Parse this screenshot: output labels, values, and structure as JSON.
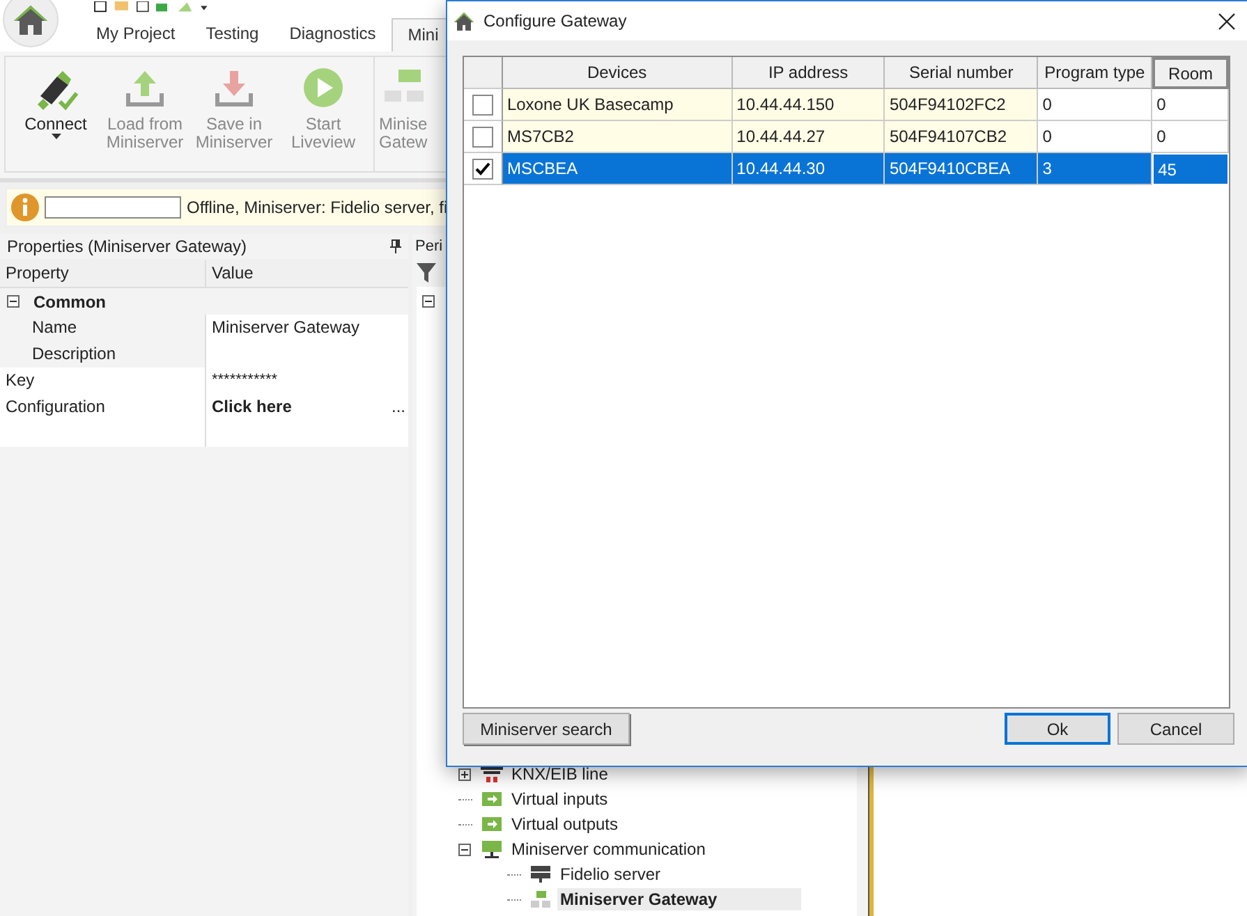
{
  "app": {
    "tabs": [
      {
        "label": "My Project",
        "selected": false
      },
      {
        "label": "Testing",
        "selected": false
      },
      {
        "label": "Diagnostics",
        "selected": false
      },
      {
        "label": "Mini",
        "selected": true
      }
    ],
    "ribbon": [
      {
        "label": "Connect",
        "kind": "connect",
        "disabled": false
      },
      {
        "label": "Load from Miniserver",
        "kind": "load",
        "disabled": true
      },
      {
        "label": "Save in Miniserver",
        "kind": "save",
        "disabled": true
      },
      {
        "label": "Start Liveview",
        "kind": "play",
        "disabled": true
      },
      {
        "label": "Minise Gatew",
        "kind": "gateway",
        "disabled": true
      }
    ],
    "info_bar": {
      "message": "Offline, Miniserver: Fidelio server, fi"
    },
    "properties": {
      "title": "Properties (Miniserver Gateway)",
      "columns": [
        "Property",
        "Value"
      ],
      "group": {
        "label": "Common",
        "expanded": true,
        "rows": [
          {
            "property": "Name",
            "value": "Miniserver Gateway"
          },
          {
            "property": "Description"
          }
        ]
      },
      "rows": [
        {
          "property": "Key",
          "value": "***********",
          "kind": "text"
        },
        {
          "property": "Configuration",
          "value": "Click here",
          "kind": "button",
          "button": "..."
        }
      ]
    },
    "periphery": {
      "title": "Peri",
      "root_expanded": true,
      "tree": [
        {
          "label": "KNX/EIB line",
          "kind": "knx",
          "expanded": false,
          "selected": false
        },
        {
          "label": "Virtual inputs",
          "kind": "virtual",
          "selected": false
        },
        {
          "label": "Virtual outputs",
          "kind": "virtual",
          "selected": false
        },
        {
          "label": "Miniserver communication",
          "kind": "network",
          "expanded": true,
          "selected": false,
          "children": [
            {
              "label": "Fidelio server",
              "kind": "server",
              "selected": false
            },
            {
              "label": "Miniserver Gateway",
              "kind": "gateway",
              "selected": true
            }
          ]
        }
      ]
    }
  },
  "dialog": {
    "title": "Configure Gateway",
    "columns": [
      "Devices",
      "IP address",
      "Serial number",
      "Program type",
      "Room"
    ],
    "rows": [
      {
        "checked": false,
        "selected": false,
        "cells": [
          "Loxone UK Basecamp",
          "10.44.44.150",
          "504F94102FC2",
          "0",
          "0"
        ]
      },
      {
        "checked": false,
        "selected": false,
        "cells": [
          "MS7CB2",
          "10.44.44.27",
          "504F94107CB2",
          "0",
          "0"
        ]
      },
      {
        "checked": true,
        "selected": true,
        "cells": [
          "MSCBEA",
          "10.44.44.30",
          "504F9410CBEA",
          "3",
          "45"
        ]
      }
    ],
    "buttons": [
      {
        "label": "Miniserver search",
        "kind": "search"
      },
      {
        "label": "Ok",
        "kind": "default"
      },
      {
        "label": "Cancel",
        "kind": "cancel"
      }
    ]
  }
}
